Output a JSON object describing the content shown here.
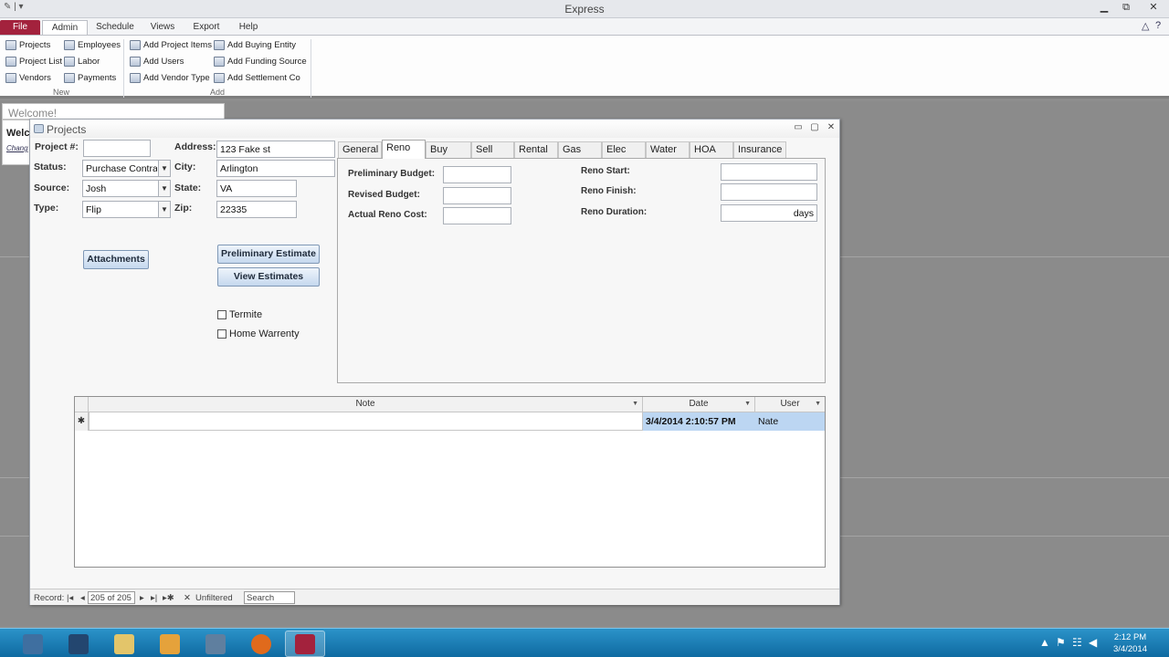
{
  "app": {
    "title": "Express"
  },
  "ribbon": {
    "tabs": [
      {
        "label": "File"
      },
      {
        "label": "Admin"
      },
      {
        "label": "Schedule"
      },
      {
        "label": "Views"
      },
      {
        "label": "Export"
      },
      {
        "label": "Help"
      }
    ],
    "active_tab": "Admin",
    "groups": {
      "new": {
        "label": "New",
        "items": [
          "Projects",
          "Employees",
          "Project List",
          "Labor",
          "Vendors",
          "Payments"
        ]
      },
      "add": {
        "label": "Add",
        "items": [
          "Add Project Items",
          "Add Buying Entity",
          "Add Users",
          "Add Funding Source",
          "Add Vendor Type",
          "Add Settlement Co"
        ]
      }
    }
  },
  "welcome": {
    "tab_label": "Welcome!",
    "heading": "Welc",
    "link": "Chang"
  },
  "projects_form": {
    "title": "Projects",
    "labels": {
      "project_no": "Project #:",
      "status": "Status:",
      "source": "Source:",
      "type": "Type:",
      "address": "Address:",
      "city": "City:",
      "state": "State:",
      "zip": "Zip:"
    },
    "values": {
      "project_no": "",
      "status": "Purchase Contract",
      "source": "Josh",
      "type": "Flip",
      "address": "123 Fake st",
      "city": "Arlington",
      "state": "VA",
      "zip": "22335"
    },
    "buttons": {
      "attachments": "Attachments",
      "preliminary_estimate": "Preliminary Estimate",
      "view_estimates": "View Estimates"
    },
    "checkboxes": {
      "termite": {
        "label": "Termite",
        "checked": false
      },
      "home_warrenty": {
        "label": "Home Warrenty",
        "checked": false
      }
    },
    "tabs": [
      "General",
      "Reno",
      "Buy",
      "Sell",
      "Rental",
      "Gas",
      "Elec",
      "Water",
      "HOA",
      "Insurance"
    ],
    "active_tab": "Reno",
    "reno": {
      "preliminary_budget_label": "Preliminary Budget:",
      "revised_budget_label": "Revised Budget:",
      "actual_reno_cost_label": "Actual Reno Cost:",
      "reno_start_label": "Reno Start:",
      "reno_finish_label": "Reno Finish:",
      "reno_duration_label": "Reno Duration:",
      "preliminary_budget": "",
      "revised_budget": "",
      "actual_reno_cost": "",
      "reno_start": "",
      "reno_finish": "",
      "reno_duration_unit": "days"
    },
    "notes_grid": {
      "columns": [
        "Note",
        "Date",
        "User"
      ],
      "new_row": {
        "marker": "✱",
        "note": "",
        "date": "3/4/2014 2:10:57 PM",
        "user": "Nate"
      }
    },
    "record_nav": {
      "label": "Record:",
      "position": "205 of 205",
      "filter": "Unfiltered",
      "search_placeholder": "Search"
    }
  },
  "taskbar": {
    "time": "2:12 PM",
    "date": "3/4/2014"
  },
  "colors": {
    "file_tab": "#a3223d",
    "taskbar": "#1a7db6",
    "grid_highlight": "#bcd6f2"
  }
}
